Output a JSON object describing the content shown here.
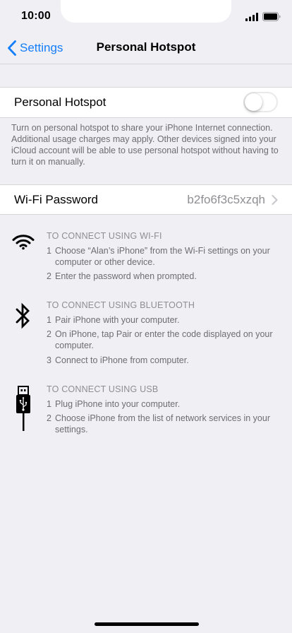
{
  "status_bar": {
    "time": "10:00"
  },
  "nav": {
    "back_label": "Settings",
    "title": "Personal Hotspot"
  },
  "hotspot": {
    "label": "Personal Hotspot",
    "toggle_on": false,
    "footer": "Turn on personal hotspot to share your iPhone Internet connection. Additional usage charges may apply. Other devices signed into your iCloud account will be able to use personal hotspot without having to turn it on manually."
  },
  "wifi_password": {
    "label": "Wi-Fi Password",
    "value": "b2fo6f3c5xzqh"
  },
  "instructions": {
    "wifi": {
      "icon": "wifi-icon",
      "title": "TO CONNECT USING WI-FI",
      "steps": [
        {
          "num": "1",
          "text": "Choose “Alan’s iPhone” from the Wi-Fi settings on your computer or other device."
        },
        {
          "num": "2",
          "text": "Enter the password when prompted."
        }
      ]
    },
    "bluetooth": {
      "icon": "bluetooth-icon",
      "title": "TO CONNECT USING BLUETOOTH",
      "steps": [
        {
          "num": "1",
          "text": "Pair iPhone with your computer."
        },
        {
          "num": "2",
          "text": "On iPhone, tap Pair or enter the code displayed on your computer."
        },
        {
          "num": "3",
          "text": "Connect to iPhone from computer."
        }
      ]
    },
    "usb": {
      "icon": "usb-icon",
      "title": "TO CONNECT USING USB",
      "steps": [
        {
          "num": "1",
          "text": "Plug iPhone into your computer."
        },
        {
          "num": "2",
          "text": "Choose iPhone from the list of network services in your settings."
        }
      ]
    }
  },
  "colors": {
    "accent": "#157efb",
    "background": "#efeff4",
    "secondary_text": "#6d6d72"
  }
}
